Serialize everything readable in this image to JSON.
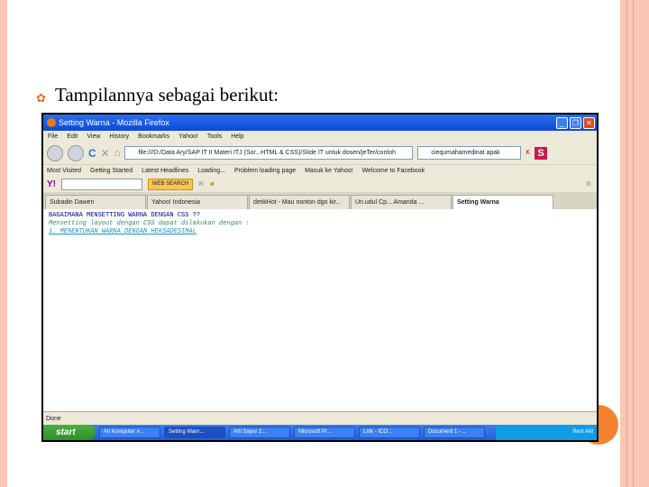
{
  "slide": {
    "heading": "Tampilannya sebagai berikut:"
  },
  "browser": {
    "title": "Setting Warna - Mozilla Firefox",
    "menu": [
      "File",
      "Edit",
      "View",
      "History",
      "Bookmarks",
      "Yahoo!",
      "Tools",
      "Help"
    ],
    "url": "file:///D:/Data Ary/SAP IT II Materi ITJ (Sor...HTML & CSS)/Slide IT untuk dosen/jeTer/contoh",
    "search": "ciequmahamedinat apak",
    "bookmarks": [
      "Most Visited",
      "Getting Started",
      "Latest Headlines",
      "Loading...",
      "Problem loading page",
      "Masuk ke Yahoo!",
      "Welcome to Facebook"
    ],
    "yahoo_button": "WEB SEARCH",
    "tabs": [
      "Subadin Dawen",
      "Yahoo! Indonesia",
      "detikHot - Mau nonton dgo kir...",
      "Un.udul Cp... Amanda ...",
      "Setting Warna"
    ],
    "content": [
      "BAGAIMANA MENSETTING WARNA DENGAN CSS ??",
      "Mensetting layout dengan CSS dapat dilakukan dengan :",
      "1. MENENTUKAN WARNA DENGAN HEKSADESIMAL"
    ],
    "status": "Done"
  },
  "taskbar": {
    "start": "start",
    "tasks": [
      "Ari Komputer #...",
      "Setting Warn...",
      "Arti Sayur 2...",
      "Microsoft Pr...",
      "Lirik - ICO...",
      "Document 1 - ..."
    ],
    "clock": "Rest AM"
  }
}
